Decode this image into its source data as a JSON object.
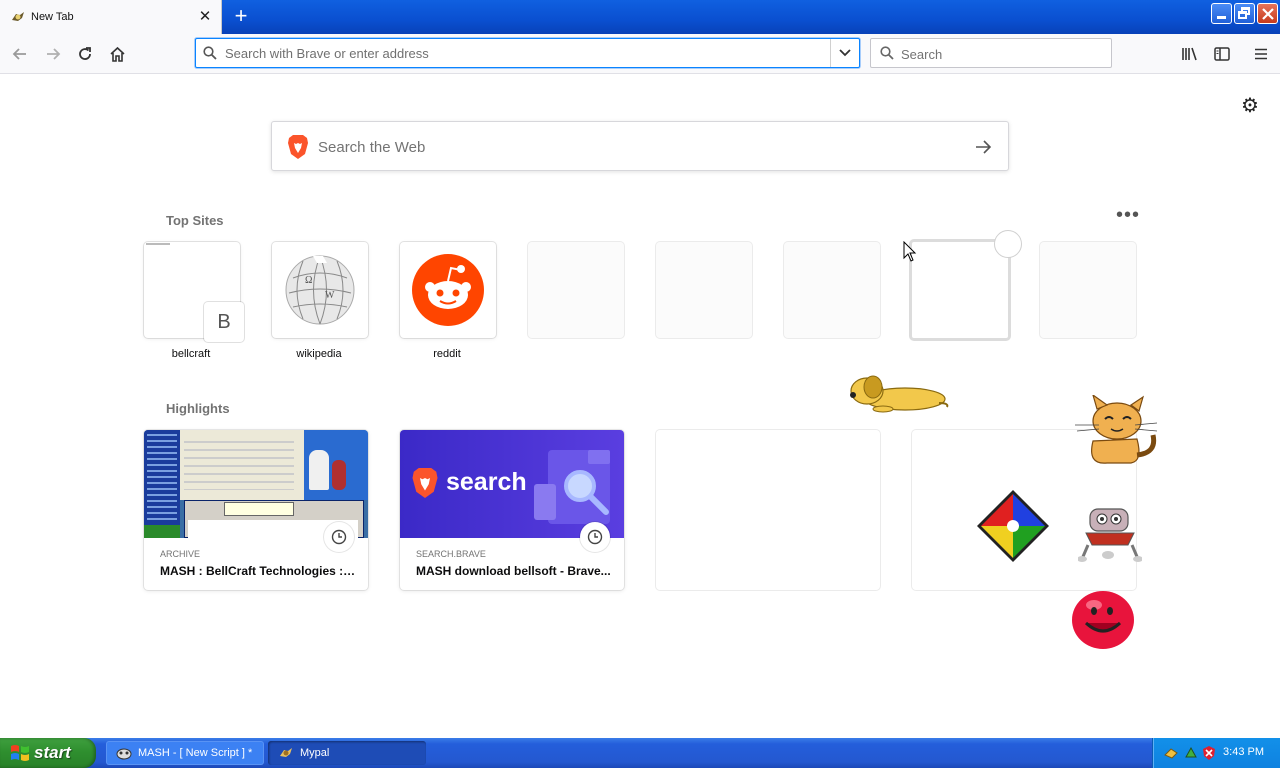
{
  "tab": {
    "title": "New Tab",
    "close_icon": "close-icon",
    "new_tab_icon": "plus-icon"
  },
  "window_controls": [
    "minimize",
    "restore",
    "close"
  ],
  "toolbar": {
    "url_placeholder": "Search with Brave or enter address",
    "search_placeholder": "Search"
  },
  "newtab": {
    "search_placeholder": "Search the Web",
    "top_sites_title": "Top Sites",
    "top_sites": [
      {
        "label": "bellcraft",
        "letter": "B"
      },
      {
        "label": "wikipedia"
      },
      {
        "label": "reddit"
      }
    ],
    "highlights_title": "Highlights",
    "highlights": [
      {
        "source": "ARCHIVE",
        "title": "MASH : BellCraft Technologies : ..."
      },
      {
        "source": "SEARCH.BRAVE",
        "title": "MASH download bellsoft - Brave...",
        "thumb_text": "search"
      }
    ]
  },
  "taskbar": {
    "start_label": "start",
    "tasks": [
      {
        "label": "MASH - [ New Script ] *"
      },
      {
        "label": "Mypal"
      }
    ],
    "clock": "3:43 PM"
  },
  "colors": {
    "accent": "#0a84ff",
    "reddit": "#ff4500",
    "brave_search": "#3b29c7",
    "taskbar": "#245edb",
    "start": "#2f8f2f"
  }
}
